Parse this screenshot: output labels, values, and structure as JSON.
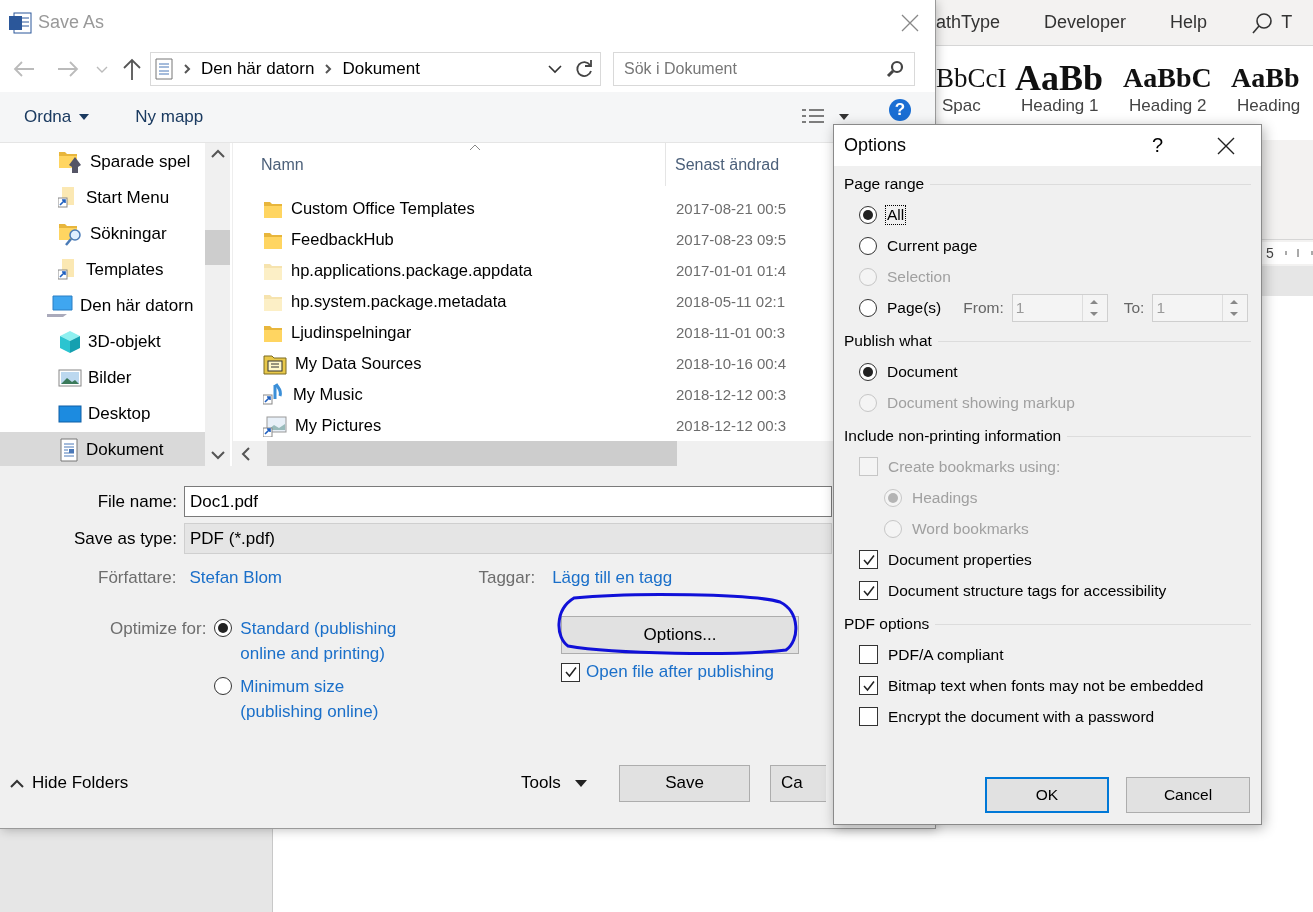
{
  "word": {
    "ribbon_tabs": [
      "athType",
      "Developer",
      "Help"
    ],
    "tell_me": "T",
    "styles": [
      {
        "preview": "BbCcI",
        "label": "Spac",
        "kind": "plain"
      },
      {
        "preview": "AaBb",
        "label": "Heading 1",
        "kind": "large"
      },
      {
        "preview": "AaBbC",
        "label": "Heading 2",
        "kind": "bold"
      },
      {
        "preview": "AaBb",
        "label": "Heading",
        "kind": "bold"
      }
    ],
    "ruler": "5"
  },
  "save_as": {
    "title": "Save As",
    "path": [
      "Den här datorn",
      "Dokument"
    ],
    "search": {
      "placeholder": "Sök i Dokument"
    },
    "toolbar": {
      "organize": "Ordna",
      "new_folder": "Ny mapp",
      "help": "?"
    },
    "sidebar": {
      "items": [
        {
          "label": "Sparade spel",
          "kind": "games",
          "selected": false
        },
        {
          "label": "Start Menu",
          "kind": "shortcut",
          "selected": false
        },
        {
          "label": "Sökningar",
          "kind": "searches",
          "selected": false
        },
        {
          "label": "Templates",
          "kind": "shortcut",
          "selected": false
        },
        {
          "label": "Den här datorn",
          "kind": "computer",
          "selected": false,
          "children": [
            {
              "label": "3D-objekt",
              "kind": "cube",
              "selected": false
            },
            {
              "label": "Bilder",
              "kind": "pictures",
              "selected": false
            },
            {
              "label": "Desktop",
              "kind": "desktop",
              "selected": false
            },
            {
              "label": "Dokument",
              "kind": "documents",
              "selected": true
            }
          ]
        }
      ]
    },
    "files": {
      "columns": [
        "Namn",
        "Senast ändrad"
      ],
      "rows": [
        {
          "name": "Custom Office Templates",
          "modified": "2017-08-21 00:5",
          "kind": "folder"
        },
        {
          "name": "FeedbackHub",
          "modified": "2017-08-23 09:5",
          "kind": "folder"
        },
        {
          "name": "hp.applications.package.appdata",
          "modified": "2017-01-01 01:4",
          "kind": "hidden-folder"
        },
        {
          "name": "hp.system.package.metadata",
          "modified": "2018-05-11 02:1",
          "kind": "hidden-folder"
        },
        {
          "name": "Ljudinspelningar",
          "modified": "2018-11-01 00:3",
          "kind": "folder"
        },
        {
          "name": "My Data Sources",
          "modified": "2018-10-16 00:4",
          "kind": "data-sources"
        },
        {
          "name": "My Music",
          "modified": "2018-12-12 00:3",
          "kind": "music"
        },
        {
          "name": "My Pictures",
          "modified": "2018-12-12 00:3",
          "kind": "pictures"
        }
      ]
    },
    "file_name": {
      "label": "File name:",
      "value": "Doc1.pdf"
    },
    "save_as_type": {
      "label": "Save as type:",
      "value": "PDF (*.pdf)"
    },
    "author": {
      "label": "Författare:",
      "value": "Stefan Blom"
    },
    "tags": {
      "label": "Taggar:",
      "value": "Lägg till en tagg"
    },
    "optimize": {
      "label": "Optimize for:",
      "options": [
        {
          "label": "Standard (publishing online and printing)",
          "selected": true
        },
        {
          "label": "Minimum size (publishing online)",
          "selected": false
        }
      ]
    },
    "options_button": "Options...",
    "open_after": {
      "label": "Open file after publishing",
      "checked": true
    },
    "hide_folders": "Hide Folders",
    "tools": "Tools",
    "buttons": [
      "Save",
      "Ca"
    ]
  },
  "options": {
    "title": "Options",
    "help": "?",
    "sections": [
      {
        "heading": "Page range",
        "items": [
          {
            "kind": "radio",
            "label": "All",
            "selected": true,
            "disabled": false,
            "focused": true
          },
          {
            "kind": "radio",
            "label": "Current page",
            "selected": false,
            "disabled": false,
            "focused": false
          },
          {
            "kind": "radio",
            "label": "Selection",
            "selected": false,
            "disabled": true,
            "focused": false
          },
          {
            "kind": "pages",
            "label": "Page(s)",
            "selected": false,
            "disabled": false,
            "focused": false,
            "from_label": "From:",
            "from_value": "1",
            "to_label": "To:",
            "to_value": "1"
          }
        ]
      },
      {
        "heading": "Publish what",
        "items": [
          {
            "kind": "radio",
            "label": "Document",
            "selected": true,
            "disabled": false
          },
          {
            "kind": "radio",
            "label": "Document showing markup",
            "selected": false,
            "disabled": true
          }
        ]
      },
      {
        "heading": "Include non-printing information",
        "items": [
          {
            "kind": "checkbox",
            "label": "Create bookmarks using:",
            "checked": false,
            "disabled": true,
            "children": [
              {
                "kind": "radio",
                "label": "Headings",
                "selected": true,
                "disabled": true
              },
              {
                "kind": "radio",
                "label": "Word bookmarks",
                "selected": false,
                "disabled": true
              }
            ]
          },
          {
            "kind": "checkbox",
            "label": "Document properties",
            "checked": true,
            "disabled": false
          },
          {
            "kind": "checkbox",
            "label": "Document structure tags for accessibility",
            "checked": true,
            "disabled": false
          }
        ]
      },
      {
        "heading": "PDF options",
        "items": [
          {
            "kind": "checkbox",
            "label": "PDF/A compliant",
            "checked": false,
            "disabled": false
          },
          {
            "kind": "checkbox",
            "label": "Bitmap text when fonts may not be embedded",
            "checked": true,
            "disabled": false
          },
          {
            "kind": "checkbox",
            "label": "Encrypt the document with a password",
            "checked": false,
            "disabled": false
          }
        ]
      }
    ],
    "buttons": [
      {
        "label": "OK",
        "default": true
      },
      {
        "label": "Cancel",
        "default": false
      }
    ]
  }
}
